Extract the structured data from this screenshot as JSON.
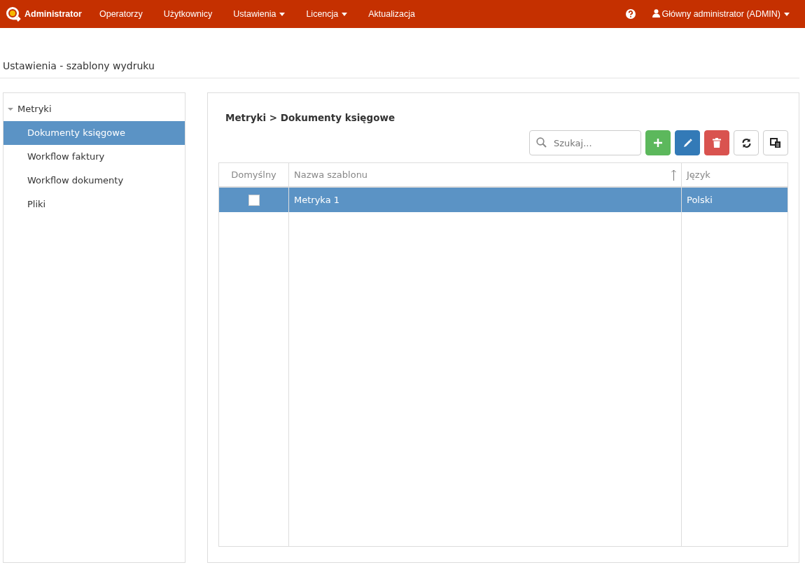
{
  "navbar": {
    "brand": "Administrator",
    "items": [
      {
        "label": "Operatorzy",
        "kind": "link"
      },
      {
        "label": "Użytkownicy",
        "kind": "link"
      },
      {
        "label": "Ustawienia",
        "kind": "dropdown"
      },
      {
        "label": "Licencja",
        "kind": "dropdown"
      },
      {
        "label": "Aktualizacja",
        "kind": "link"
      }
    ],
    "user": "Główny administrator (ADMIN)"
  },
  "page_title": "Ustawienia - szablony wydruku",
  "tree": [
    {
      "label": "Metryki",
      "expanded": true,
      "selected": false,
      "children": [
        {
          "label": "Dokumenty księgowe",
          "selected": true
        },
        {
          "label": "Workflow faktury",
          "selected": false
        },
        {
          "label": "Workflow dokumenty",
          "selected": false
        },
        {
          "label": "Pliki",
          "selected": false
        }
      ]
    }
  ],
  "breadcrumb": "Metryki > Dokumenty księgowe",
  "search": {
    "placeholder": "Szukaj..."
  },
  "table": {
    "columns": [
      {
        "label": "Domyślny",
        "sorted": false
      },
      {
        "label": "Nazwa szablonu",
        "sorted": true
      },
      {
        "label": "Język",
        "sorted": false
      }
    ],
    "rows": [
      {
        "default": false,
        "name": "Metryka 1",
        "language": "Polski",
        "selected": true
      }
    ]
  }
}
